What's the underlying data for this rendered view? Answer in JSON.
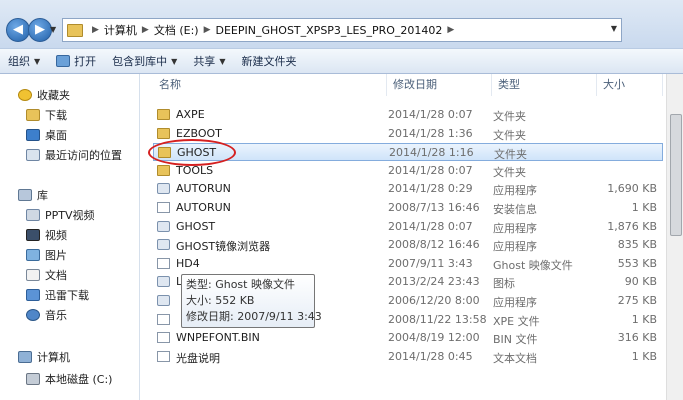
{
  "breadcrumbs": [
    "计算机",
    "文档 (E:)",
    "DEEPIN_GHOST_XPSP3_LES_PRO_201402"
  ],
  "toolbar": {
    "organize": "组织",
    "open": "打开",
    "include": "包含到库中",
    "share": "共享",
    "newfolder": "新建文件夹"
  },
  "sidebar": {
    "items": [
      {
        "label": "收藏夹",
        "icon": "star-icon"
      },
      {
        "label": "下载",
        "icon": "download-folder-icon"
      },
      {
        "label": "桌面",
        "icon": "desktop-icon"
      },
      {
        "label": "最近访问的位置",
        "icon": "recent-places-icon"
      },
      {
        "label": "库",
        "icon": "library-icon"
      },
      {
        "label": "PPTV视频",
        "icon": "video-library-icon"
      },
      {
        "label": "视频",
        "icon": "video-icon"
      },
      {
        "label": "图片",
        "icon": "picture-icon"
      },
      {
        "label": "文档",
        "icon": "document-library-icon"
      },
      {
        "label": "迅雷下载",
        "icon": "download-library-icon"
      },
      {
        "label": "音乐",
        "icon": "music-icon"
      },
      {
        "label": "计算机",
        "icon": "computer-icon"
      },
      {
        "label": "本地磁盘 (C:)",
        "icon": "drive-icon"
      }
    ]
  },
  "columns": {
    "name": "名称",
    "date": "修改日期",
    "type": "类型",
    "size": "大小"
  },
  "files": [
    {
      "name": "AXPE",
      "date": "2014/1/28 0:07",
      "type": "文件夹",
      "size": "",
      "icon": "folder-icon"
    },
    {
      "name": "EZBOOT",
      "date": "2014/1/28 1:36",
      "type": "文件夹",
      "size": "",
      "icon": "folder-icon"
    },
    {
      "name": "GHOST",
      "date": "2014/1/28 1:16",
      "type": "文件夹",
      "size": "",
      "icon": "folder-icon"
    },
    {
      "name": "TOOLS",
      "date": "2014/1/28 0:07",
      "type": "文件夹",
      "size": "",
      "icon": "folder-icon"
    },
    {
      "name": "AUTORUN",
      "date": "2014/1/28 0:29",
      "type": "应用程序",
      "size": "1,690 KB",
      "icon": "autorun-app-icon"
    },
    {
      "name": "AUTORUN",
      "date": "2008/7/13 16:46",
      "type": "安装信息",
      "size": "1 KB",
      "icon": "setup-info-icon"
    },
    {
      "name": "GHOST",
      "date": "2014/1/28 0:07",
      "type": "应用程序",
      "size": "1,876 KB",
      "icon": "ghost-app-icon"
    },
    {
      "name": "GHOST镜像浏览器",
      "date": "2008/8/12 16:46",
      "type": "应用程序",
      "size": "835 KB",
      "icon": "ghost-explorer-icon"
    },
    {
      "name": "HD4",
      "date": "2007/9/11 3:43",
      "type": "Ghost 映像文件",
      "size": "553 KB",
      "icon": "ghost-image-file-icon"
    },
    {
      "name": "L",
      "date": "2013/2/24 23:43",
      "type": "图标",
      "size": "90 KB",
      "icon": "icon-file-icon"
    },
    {
      "name": "",
      "date": "2006/12/20 8:00",
      "type": "应用程序",
      "size": "275 KB",
      "icon": "app-icon"
    },
    {
      "name": "",
      "date": "2008/11/22 13:58",
      "type": "XPE 文件",
      "size": "1 KB",
      "icon": "xpe-file-icon"
    },
    {
      "name": "WNPEFONT.BIN",
      "date": "2004/8/19 12:00",
      "type": "BIN 文件",
      "size": "316 KB",
      "icon": "bin-file-icon"
    },
    {
      "name": "光盘说明",
      "date": "2014/1/28 0:45",
      "type": "文本文档",
      "size": "1 KB",
      "icon": "text-file-icon"
    }
  ],
  "tooltip": {
    "type": "类型: Ghost 映像文件",
    "size": "大小: 552 KB",
    "date": "修改日期: 2007/9/11 3:43"
  }
}
